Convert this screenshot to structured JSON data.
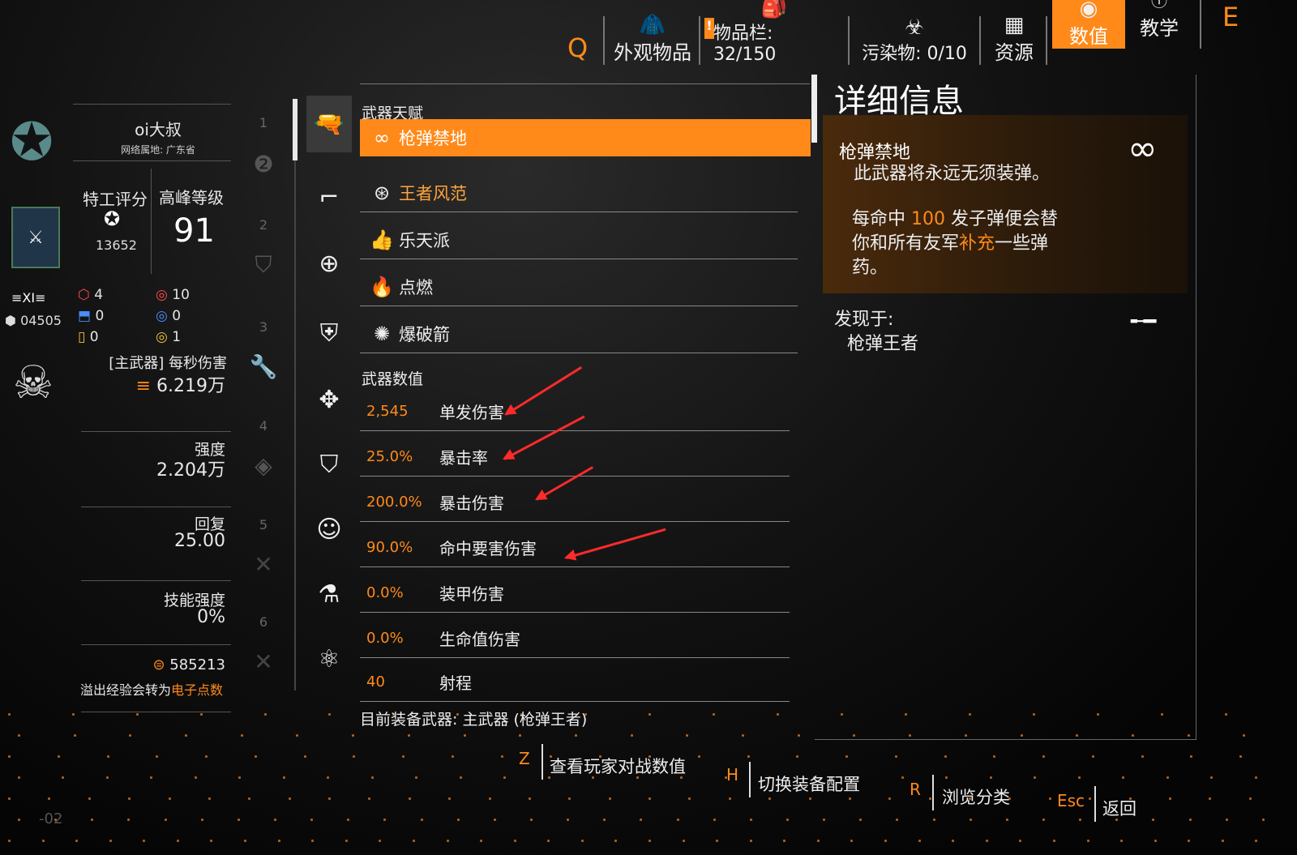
{
  "topbar": {
    "key_left": "Q",
    "key_right": "E",
    "appearance": "外观物品",
    "inventory": "物品栏: 32/150",
    "contaminated": "污染物: 0/10",
    "resources": "资源",
    "stats": "数值",
    "tutorial": "教学",
    "warn": "!"
  },
  "profile": {
    "name": "oi大叔",
    "location": "网络属地: 广东省",
    "agent_score_label": "特工评分",
    "agent_score": "13652",
    "peak_level_label": "高峰等级",
    "peak_level": "91",
    "rank": "≡XI≡",
    "rank_points": "04505",
    "counts": {
      "red_a": "4",
      "blue_a": "0",
      "yellow_a": "0",
      "red_b": "10",
      "blue_b": "0",
      "yellow_b": "1"
    },
    "dps_label": "[主武器] 每秒伤害",
    "dps": "6.219万",
    "armor_label": "强度",
    "armor": "2.204万",
    "regen_label": "回复",
    "regen": "25.00",
    "skill_label": "技能强度",
    "skill": "0%",
    "credits": "585213",
    "overflow_text": "溢出经验会转为",
    "overflow_highlight": "电子点数",
    "corner_num": "-02"
  },
  "slots": [
    "1",
    "2",
    "3",
    "4",
    "5",
    "6"
  ],
  "talents": {
    "section_label": "武器天赋",
    "items": [
      {
        "name": "枪弹禁地",
        "icon": "infinity-icon"
      },
      {
        "name": "王者风范",
        "icon": "crown-swirl-icon"
      },
      {
        "name": "乐天派",
        "icon": "thumbs-up-icon"
      },
      {
        "name": "点燃",
        "icon": "flame-icon"
      },
      {
        "name": "爆破箭",
        "icon": "explosive-bolt-icon"
      }
    ]
  },
  "weapon_stats": {
    "section_label": "武器数值",
    "items": [
      {
        "value": "2,545",
        "name": "单发伤害"
      },
      {
        "value": "25.0%",
        "name": "暴击率"
      },
      {
        "value": "200.0%",
        "name": "暴击伤害"
      },
      {
        "value": "90.0%",
        "name": "命中要害伤害"
      },
      {
        "value": "0.0%",
        "name": "装甲伤害"
      },
      {
        "value": "0.0%",
        "name": "生命值伤害"
      },
      {
        "value": "40",
        "name": "射程"
      }
    ],
    "equipped": "目前装备武器: 主武器 (枪弹王者)"
  },
  "detail": {
    "title": "详细信息",
    "talent_name": "枪弹禁地",
    "line1": "此武器将永远无须装弹。",
    "line2a": "每命中 ",
    "line2_num": "100",
    "line2b": " 发子弹便会替",
    "line3a": "你和所有友军",
    "line3_hl": "补充",
    "line3b": "一些弹",
    "line4": "药。",
    "found_label": "发现于:",
    "found_item": "枪弹王者"
  },
  "hints": [
    {
      "key": "Z",
      "label": "查看玩家对战数值"
    },
    {
      "key": "H",
      "label": "切换装备配置"
    },
    {
      "key": "R",
      "label": "浏览分类"
    },
    {
      "key": "Esc",
      "label": "返回"
    }
  ],
  "colors": {
    "accent": "#ff8a1a",
    "annotation": "#ff2a2a"
  }
}
